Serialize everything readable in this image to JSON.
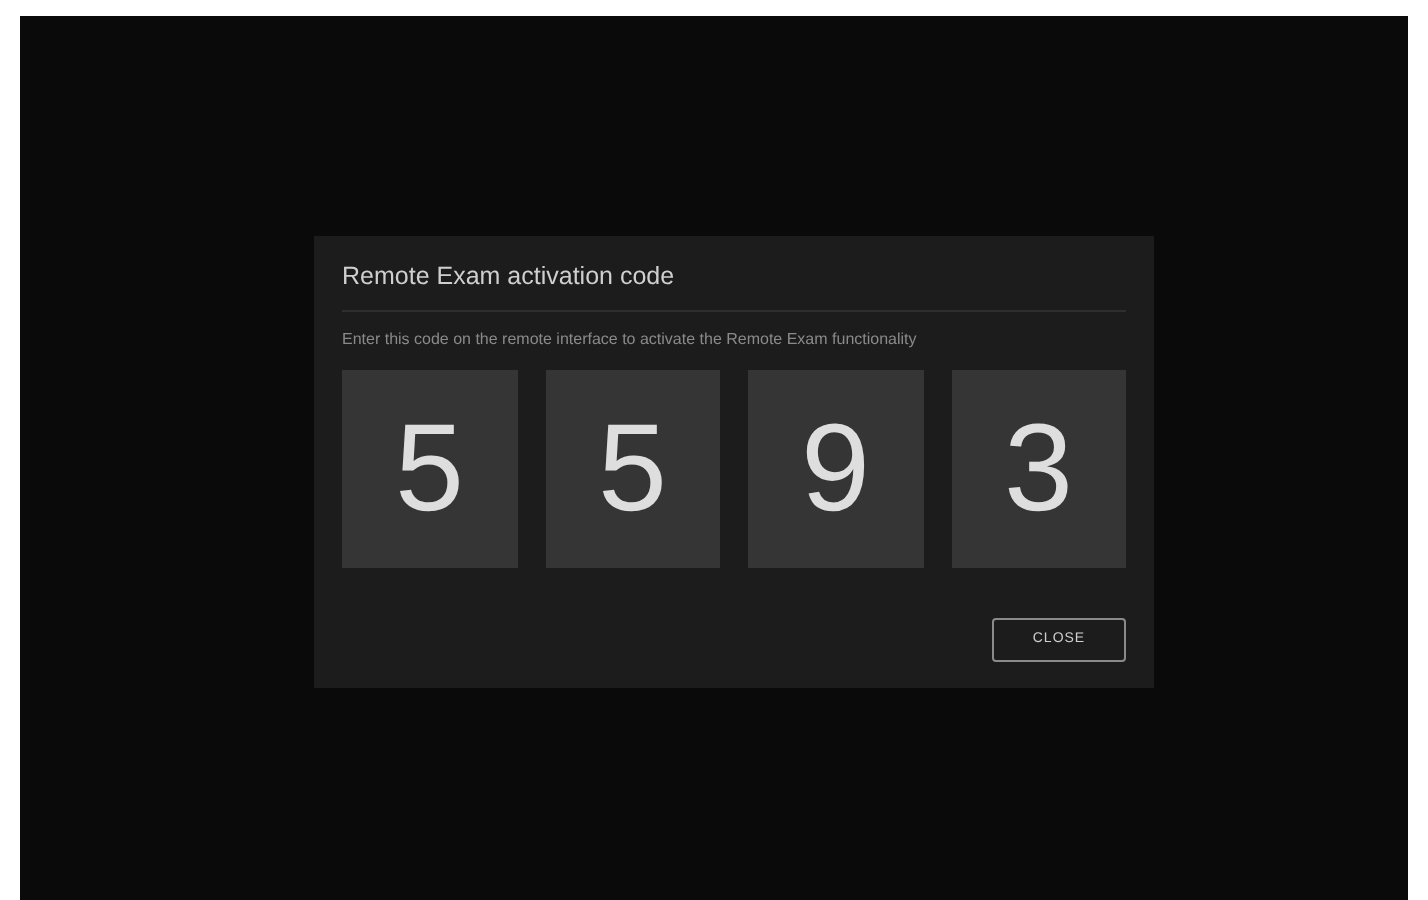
{
  "dialog": {
    "title": "Remote Exam activation code",
    "description": "Enter this code on the remote interface to activate the Remote Exam functionality",
    "code_digits": [
      "5",
      "5",
      "9",
      "3"
    ],
    "close_button": "CLOSE"
  }
}
